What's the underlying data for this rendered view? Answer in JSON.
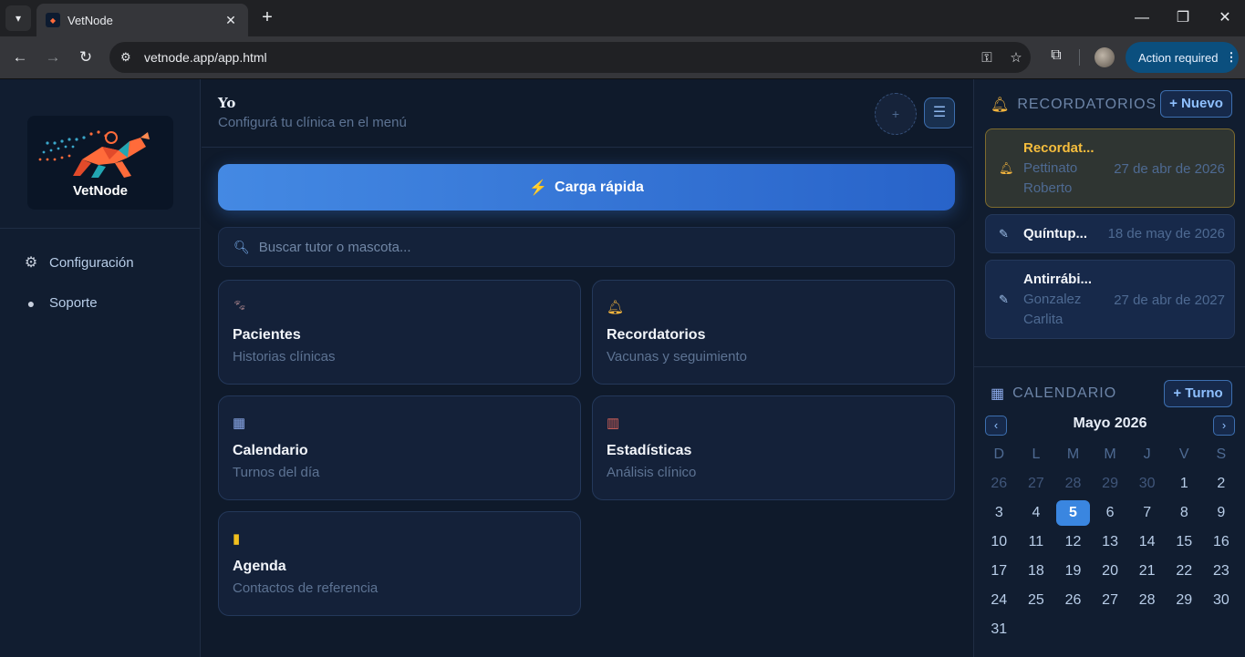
{
  "browser": {
    "tab_title": "VetNode",
    "url": "vetnode.app/app.html",
    "action_label": "Action required"
  },
  "sidebar": {
    "logo_name": "VetNode",
    "items": [
      {
        "label": "Configuración",
        "icon": "gear-icon"
      },
      {
        "label": "Soporte",
        "icon": "speech-bubble-icon"
      }
    ]
  },
  "header": {
    "name": "Yo",
    "subtitle": "Configurá tu clínica en el menú"
  },
  "main": {
    "quick_label": "Carga rápida",
    "search_placeholder": "Buscar tutor o mascota...",
    "cards": [
      {
        "title": "Pacientes",
        "subtitle": "Historias clínicas",
        "icon": "paw-icon"
      },
      {
        "title": "Recordatorios",
        "subtitle": "Vacunas y seguimiento",
        "icon": "bell-icon"
      },
      {
        "title": "Calendario",
        "subtitle": "Turnos del día",
        "icon": "calendar-icon"
      },
      {
        "title": "Estadísticas",
        "subtitle": "Análisis clínico",
        "icon": "bar-chart-icon"
      },
      {
        "title": "Agenda",
        "subtitle": "Contactos de referencia",
        "icon": "notebook-icon"
      }
    ]
  },
  "reminders": {
    "title": "RECORDATORIOS",
    "new_label": "+ Nuevo",
    "items": [
      {
        "title": "Recordat...",
        "name": "Pettinato Roberto",
        "date": "27 de abr de 2026",
        "icon": "bell-icon",
        "status": "warning"
      },
      {
        "title": "Quíntup...",
        "name": "",
        "date": "18 de may de 2026",
        "icon": "syringe-icon",
        "status": "normal"
      },
      {
        "title": "Antirrábi...",
        "name": "Gonzalez Carlita",
        "date": "27 de abr de 2027",
        "icon": "syringe-icon",
        "status": "normal"
      }
    ]
  },
  "calendar": {
    "title": "CALENDARIO",
    "new_label": "+ Turno",
    "month": "Mayo 2026",
    "prev": "‹",
    "next": "›",
    "weekdays": [
      "D",
      "L",
      "M",
      "M",
      "J",
      "V",
      "S"
    ],
    "prev_month_days": [
      "26",
      "27",
      "28",
      "29",
      "30"
    ],
    "days": [
      "1",
      "2",
      "3",
      "4",
      "5",
      "6",
      "7",
      "8",
      "9",
      "10",
      "11",
      "12",
      "13",
      "14",
      "15",
      "16",
      "17",
      "18",
      "19",
      "20",
      "21",
      "22",
      "23",
      "24",
      "25",
      "26",
      "27",
      "28",
      "29",
      "30",
      "31"
    ],
    "today": "5"
  }
}
